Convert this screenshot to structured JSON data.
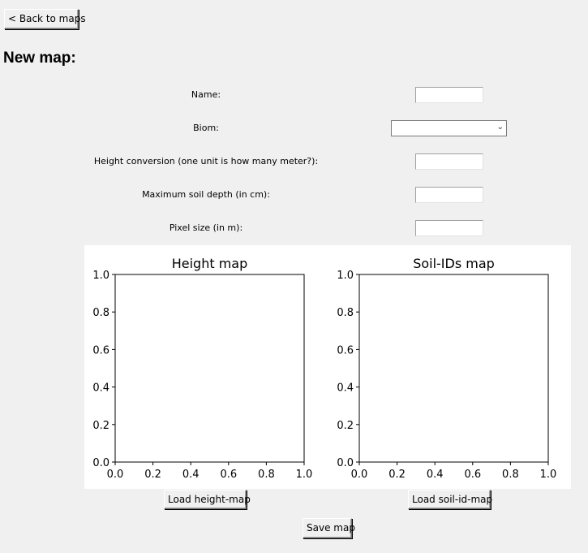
{
  "back_button": "< Back to maps",
  "page_title": "New map:",
  "form": {
    "name_label": "Name:",
    "name_value": "",
    "biom_label": "Biom:",
    "biom_value": "",
    "height_conv_label": "Height conversion (one unit is how many meter?):",
    "height_conv_value": "",
    "soil_depth_label": "Maximum soil depth (in cm):",
    "soil_depth_value": "",
    "pixel_size_label": "Pixel size (in m):",
    "pixel_size_value": ""
  },
  "chart_data": [
    {
      "type": "heatmap",
      "title": "Height map",
      "xlim": [
        0.0,
        1.0
      ],
      "ylim": [
        0.0,
        1.0
      ],
      "x_ticks": [
        "0.0",
        "0.2",
        "0.4",
        "0.6",
        "0.8",
        "1.0"
      ],
      "y_ticks": [
        "0.0",
        "0.2",
        "0.4",
        "0.6",
        "0.8",
        "1.0"
      ],
      "values": [],
      "grid": false
    },
    {
      "type": "heatmap",
      "title": "Soil-IDs map",
      "xlim": [
        0.0,
        1.0
      ],
      "ylim": [
        0.0,
        1.0
      ],
      "x_ticks": [
        "0.0",
        "0.2",
        "0.4",
        "0.6",
        "0.8",
        "1.0"
      ],
      "y_ticks": [
        "0.0",
        "0.2",
        "0.4",
        "0.6",
        "0.8",
        "1.0"
      ],
      "values": [],
      "grid": false
    }
  ],
  "buttons": {
    "load_height": "Load height-map",
    "load_soil": "Load soil-id-map",
    "save": "Save map"
  }
}
